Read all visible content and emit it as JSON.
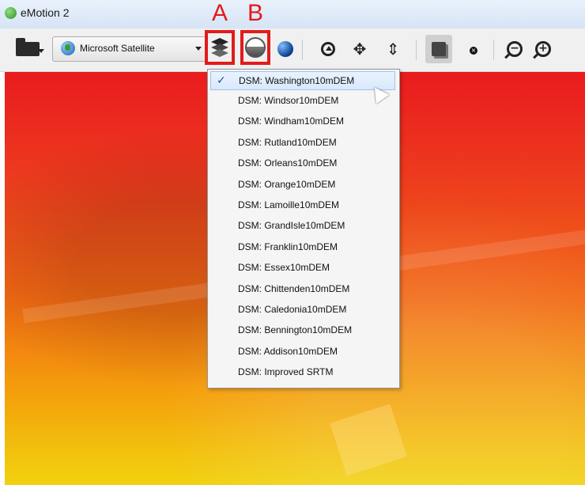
{
  "window": {
    "title": "eMotion 2"
  },
  "toolbar": {
    "basemap_label": "Microsoft Satellite"
  },
  "annotations": {
    "a": "A",
    "b": "B"
  },
  "menu": {
    "items": [
      {
        "label": "DSM: Washington10mDEM",
        "checked": true
      },
      {
        "label": "DSM: Windsor10mDEM"
      },
      {
        "label": "DSM: Windham10mDEM"
      },
      {
        "label": "DSM: Rutland10mDEM"
      },
      {
        "label": "DSM: Orleans10mDEM"
      },
      {
        "label": "DSM: Orange10mDEM"
      },
      {
        "label": "DSM: Lamoille10mDEM"
      },
      {
        "label": "DSM: GrandIsle10mDEM"
      },
      {
        "label": "DSM: Franklin10mDEM"
      },
      {
        "label": "DSM: Essex10mDEM"
      },
      {
        "label": "DSM: Chittenden10mDEM"
      },
      {
        "label": "DSM: Caledonia10mDEM"
      },
      {
        "label": "DSM: Bennington10mDEM"
      },
      {
        "label": "DSM: Addison10mDEM"
      },
      {
        "label": "DSM: Improved SRTM"
      }
    ],
    "check_glyph": "✓"
  },
  "colors": {
    "highlight": "#e21b1b",
    "map_top": "#e91b1e",
    "map_bottom": "#f1d10f"
  }
}
